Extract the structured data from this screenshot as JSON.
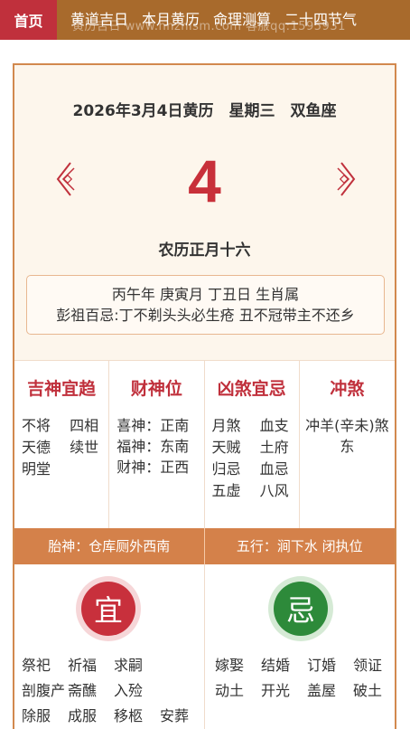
{
  "nav": {
    "home": "首页",
    "items": [
      "黄道吉日",
      "本月黄历",
      "命理测算",
      "二十四节气"
    ],
    "watermark": "黄历吉日 www.hnznlsm.com 客服qq:1595931"
  },
  "almanac": {
    "date_line": "2026年3月4日黄历　星期三　双鱼座",
    "day": "4",
    "lunar": "农历正月十六",
    "ganzhi": "丙午年 庚寅月 丁丑日 生肖属",
    "pengzu": "彭祖百忌:丁不剃头头必生疮 丑不冠带主不还乡"
  },
  "sections": {
    "jishen": {
      "title": "吉神宜趋",
      "items": [
        "不将",
        "四相",
        "天德",
        "续世",
        "明堂"
      ]
    },
    "caishen": {
      "title": "财神位",
      "items": [
        "喜神：正南",
        "福神：东南",
        "财神：正西"
      ]
    },
    "xiongsha": {
      "title": "凶煞宜忌",
      "items": [
        "月煞",
        "血支",
        "天贼",
        "土府",
        "归忌",
        "血忌",
        "五虚",
        "八风"
      ]
    },
    "chongsha": {
      "title": "冲煞",
      "text": "冲羊(辛未)煞东"
    }
  },
  "bar": {
    "taishen": "胎神：仓库厕外西南",
    "wuxing": "五行：涧下水 闭执位"
  },
  "yi": {
    "stamp": "宜",
    "items": [
      "祭祀",
      "祈福",
      "求嗣",
      "",
      "剖腹产",
      "斋醮",
      "入殓",
      "",
      "除服",
      "成服",
      "移柩",
      "安葬"
    ]
  },
  "ji": {
    "stamp": "忌",
    "items": [
      "嫁娶",
      "结婚",
      "订婚",
      "领证",
      "动土",
      "开光",
      "盖屋",
      "破土"
    ]
  },
  "colors": {
    "nav_bg": "#a86a2c",
    "home_bg": "#c0303c",
    "accent_red": "#c8303a",
    "bar_bg": "#d4814a",
    "ji_green": "#2d8a3a"
  },
  "icons": {
    "prev": "chevron-left-icon",
    "next": "chevron-right-icon"
  }
}
